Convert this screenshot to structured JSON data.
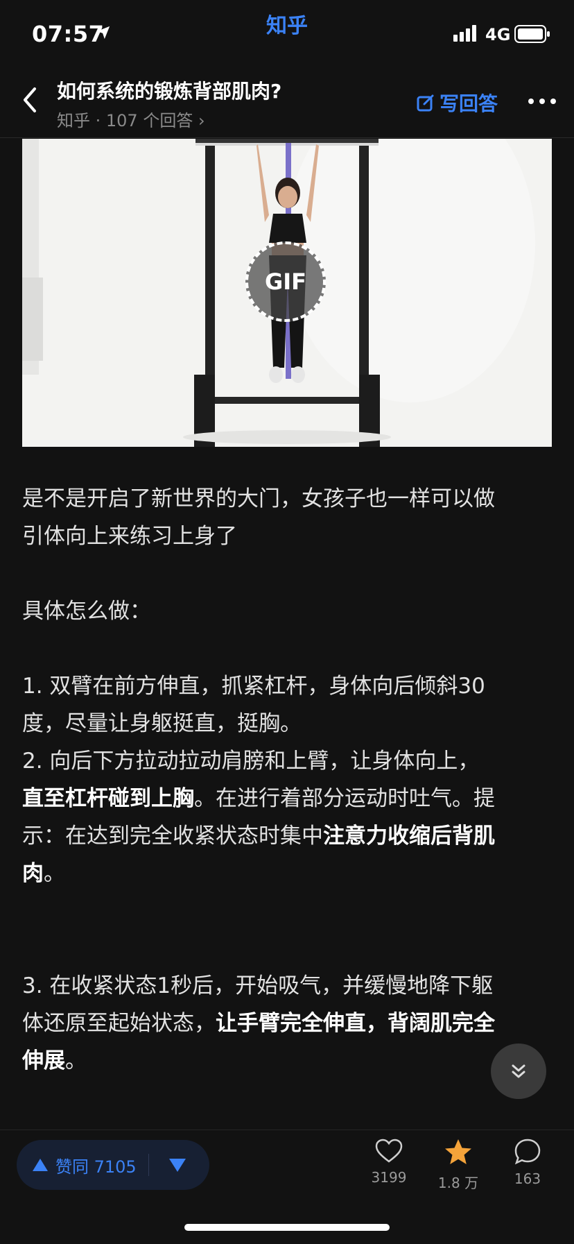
{
  "status_bar": {
    "time": "07:57",
    "app_name": "知乎",
    "network": "4G"
  },
  "nav": {
    "title": "如何系统的锻炼背部肌肉?",
    "subtitle": "知乎 · 107 个回答",
    "write_answer": "写回答",
    "accent": "#3b82f6"
  },
  "media": {
    "badge": "GIF"
  },
  "content": {
    "intro_l1": "是不是开启了新世界的大门，女孩子也一样可以做",
    "intro_l2": "引体向上来练习上身了",
    "how_to": "具体怎么做：",
    "s1_l1": "1. 双臂在前方伸直，抓紧杠杆，身体向后倾斜30",
    "s1_l2": "度，尽量让身躯挺直，挺胸。",
    "s2_l1": "2. 向后下方拉动拉动肩膀和上臂，让身体向上，",
    "s2_l2_bold": "直至杠杆碰到上胸",
    "s2_l2_rest": "。在进行着部分运动时吐气。提",
    "s2_l3_a": "示：在达到完全收紧状态时集中",
    "s2_l3_bold": "注意力收缩后背肌",
    "s2_l4_bold": "肉",
    "s2_l4_rest": "。",
    "s3_l1": "3. 在收紧状态1秒后，开始吸气，并缓慢地降下躯",
    "s3_l2_a": "体还原至起始状态，",
    "s3_l2_bold": "让手臂完全伸直，背阔肌完全",
    "s3_l3_bold": "伸展",
    "s3_l3_rest": "。"
  },
  "bottom": {
    "vote_label": "赞同 7105",
    "like_count": "3199",
    "fav_count": "1.8 万",
    "comment_count": "163"
  }
}
